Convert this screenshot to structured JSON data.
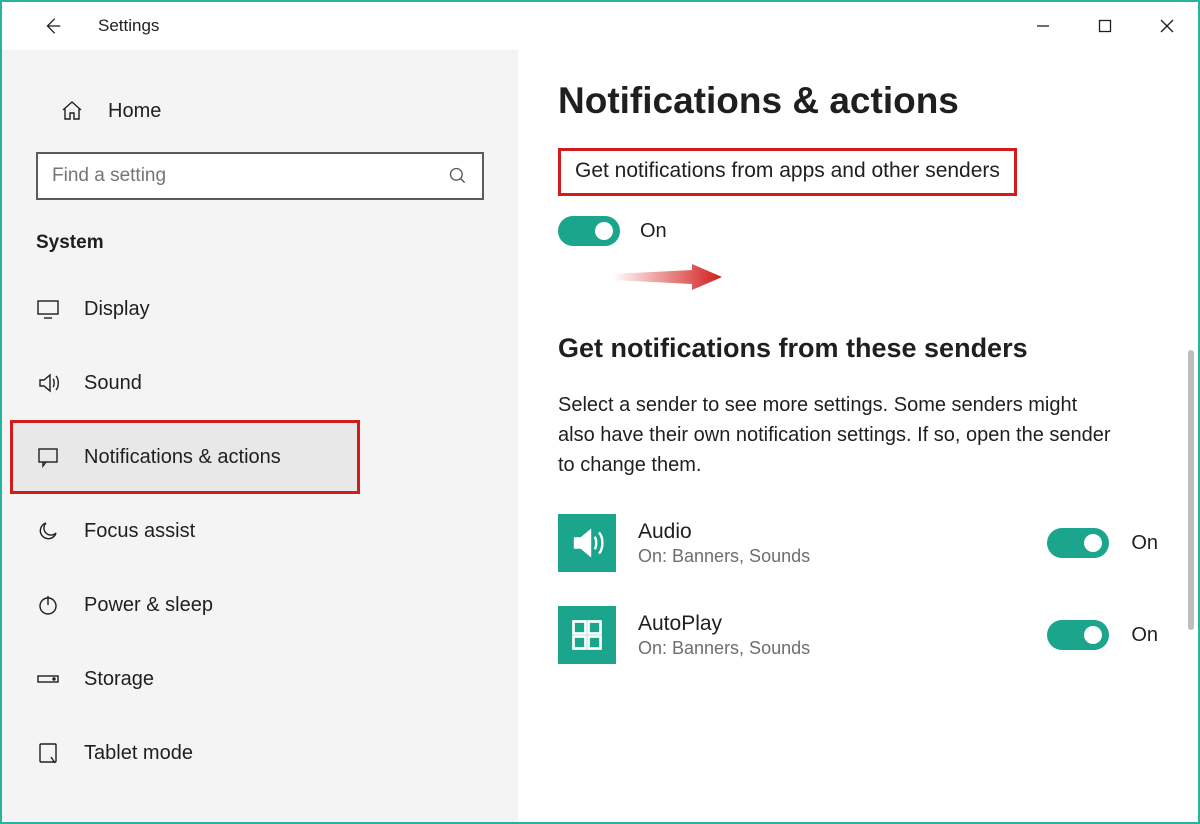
{
  "titlebar": {
    "title": "Settings"
  },
  "sidebar": {
    "home": "Home",
    "search_placeholder": "Find a setting",
    "category": "System",
    "items": [
      {
        "label": "Display"
      },
      {
        "label": "Sound"
      },
      {
        "label": "Notifications & actions"
      },
      {
        "label": "Focus assist"
      },
      {
        "label": "Power & sleep"
      },
      {
        "label": "Storage"
      },
      {
        "label": "Tablet mode"
      }
    ]
  },
  "content": {
    "heading": "Notifications & actions",
    "main_toggle_text": "Get notifications from apps and other senders",
    "main_toggle_state": "On",
    "section_heading": "Get notifications from these senders",
    "section_desc": "Select a sender to see more settings. Some senders might also have their own notification settings. If so, open the sender to change them.",
    "senders": [
      {
        "name": "Audio",
        "sub": "On: Banners, Sounds",
        "state": "On"
      },
      {
        "name": "AutoPlay",
        "sub": "On: Banners, Sounds",
        "state": "On"
      }
    ]
  }
}
